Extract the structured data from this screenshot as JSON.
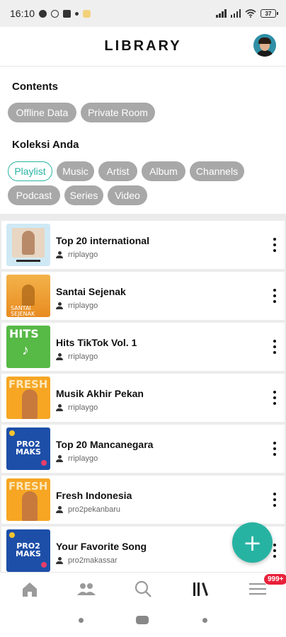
{
  "status_bar": {
    "time": "16:10",
    "battery": "37"
  },
  "header": {
    "title": "LIBRARY"
  },
  "contents": {
    "title": "Contents",
    "chips": [
      "Offline Data",
      "Private Room"
    ]
  },
  "koleksi": {
    "title": "Koleksi Anda",
    "chips_row1": [
      "Playlist",
      "Music",
      "Artist",
      "Album",
      "Channels"
    ],
    "chips_row2": [
      "Podcast",
      "Series",
      "Video"
    ],
    "active": "Playlist"
  },
  "playlists": [
    {
      "title": "Top 20 international",
      "owner": "rriplaygo",
      "thumb_text": "",
      "thumb_color": "#cfe9f4"
    },
    {
      "title": "Santai Sejenak",
      "owner": "rriplaygo",
      "thumb_text": "SANTAI SEJENAK",
      "thumb_color": "#f0a530"
    },
    {
      "title": "Hits TikTok Vol. 1",
      "owner": "rriplaygo",
      "thumb_text": "HITS",
      "thumb_color": "#57b946"
    },
    {
      "title": "Musik Akhir Pekan",
      "owner": "rriplaygo",
      "thumb_text": "FRESH",
      "thumb_color": "#f6a623"
    },
    {
      "title": "Top 20 Mancanegara",
      "owner": "rriplaygo",
      "thumb_text": "PRO2 MAKS",
      "thumb_color": "#1d4fa8"
    },
    {
      "title": "Fresh Indonesia",
      "owner": "pro2pekanbaru",
      "thumb_text": "FRESH",
      "thumb_color": "#f6a623"
    },
    {
      "title": "Your Favorite Song",
      "owner": "pro2makassar",
      "thumb_text": "PRO2 MAKS",
      "thumb_color": "#1d4fa8"
    }
  ],
  "fab": {
    "label": "+"
  },
  "bottom_nav": {
    "items": [
      "home-icon",
      "community-icon",
      "search-icon",
      "library-icon",
      "menu-icon"
    ],
    "badge": "999+"
  },
  "colors": {
    "accent": "#27b3a2",
    "chip": "#a8a8a8",
    "badge": "#e8203a"
  }
}
